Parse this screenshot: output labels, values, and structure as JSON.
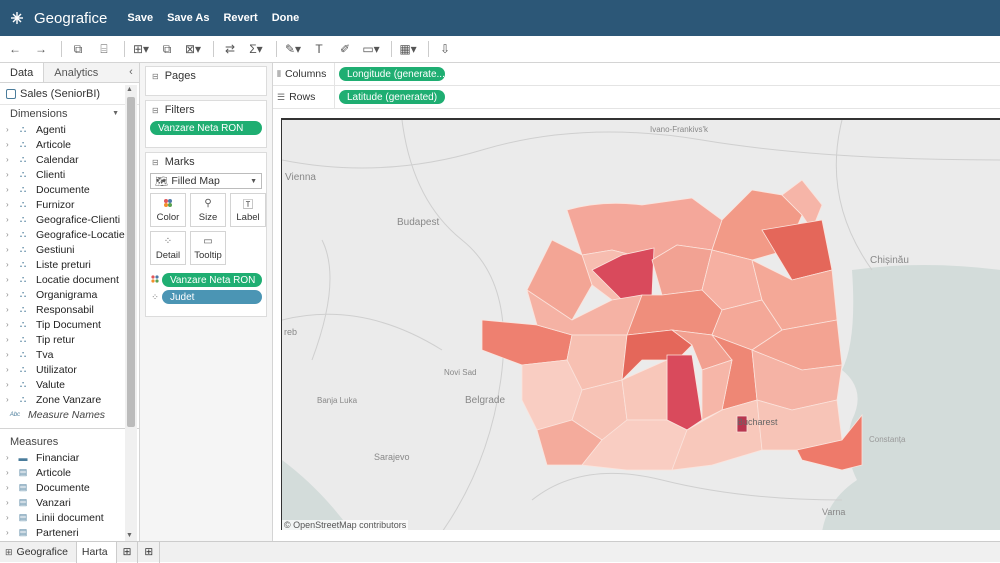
{
  "app": {
    "title": "Geografice",
    "menu": [
      "Save",
      "Save As",
      "Revert",
      "Done"
    ]
  },
  "toolbar": {
    "icons": [
      "back-icon",
      "forward-icon",
      "new-datasource-icon",
      "pause-icon",
      "new-worksheet-icon",
      "duplicate-icon",
      "clear-icon",
      "swap-icon",
      "totals-icon",
      "highlight-icon",
      "text-label-icon",
      "annotation-icon",
      "fit-icon",
      "show-me-icon",
      "present-icon"
    ]
  },
  "left_panel": {
    "tabs": [
      "Data",
      "Analytics"
    ],
    "datasource": "Sales (SeniorBI)",
    "dimensions_header": "Dimensions",
    "dimensions": [
      "Agenti",
      "Articole",
      "Calendar",
      "Clienti",
      "Documente",
      "Furnizor",
      "Geografice-Clienti",
      "Geografice-Locatie",
      "Gestiuni",
      "Liste preturi",
      "Locatie document",
      "Organigrama",
      "Responsabil",
      "Tip Document",
      "Tip retur",
      "Tva",
      "Utilizator",
      "Valute",
      "Zone Vanzare"
    ],
    "measure_names": "Measure Names",
    "abc_label": "Abc",
    "measures_header": "Measures",
    "measures": [
      "Financiar",
      "Articole",
      "Documente",
      "Vanzari",
      "Linii document",
      "Parteneri"
    ]
  },
  "cards": {
    "pages": "Pages",
    "filters": "Filters",
    "filter_pill": "Vanzare Neta RON",
    "marks": "Marks",
    "mark_type": "Filled Map",
    "buttons": [
      "Color",
      "Size",
      "Label",
      "Detail",
      "Tooltip"
    ],
    "mark_pills": [
      "Vanzare Neta RON",
      "Judet"
    ]
  },
  "shelves": {
    "columns_label": "Columns",
    "columns_pill": "Longitude (generate...",
    "rows_label": "Rows",
    "rows_pill": "Latitude (generated)"
  },
  "map": {
    "cities": [
      "Ivano-Frankivs'k",
      "Vienna",
      "Budapest",
      "Chisinau",
      "Novi Sad",
      "Belgrade",
      "Banja Luka",
      "Sarajevo",
      "Bucharest",
      "Varna",
      "Zagreb",
      "Constanta"
    ],
    "visible_labels": {
      "ivano": "Ivano-Frankivs'k",
      "vienna": "Vienna",
      "budapest": "Budapest",
      "chisinau": "Chișinău",
      "novisad": "Novi Sad",
      "belgrade": "Belgrade",
      "banjaluka": "Banja Luka",
      "sarajevo": "Sarajevo",
      "bucharest": "Bucharest",
      "varna": "Varna",
      "zagreb": "reb",
      "constanta": "Constanța"
    },
    "attribution": "© OpenStreetMap contributors",
    "colors": {
      "low": "#f9cdc2",
      "mid": "#f29a87",
      "high": "#d94a5c",
      "top": "#b8364f",
      "water": "#d3dcda",
      "land": "#ebebeb"
    }
  },
  "sheet_tabs": [
    "Geografice",
    "Harta"
  ],
  "colors": {
    "titlebar": "#2c5777",
    "green_pill": "#1fae72",
    "blue_pill": "#4b95b4"
  }
}
